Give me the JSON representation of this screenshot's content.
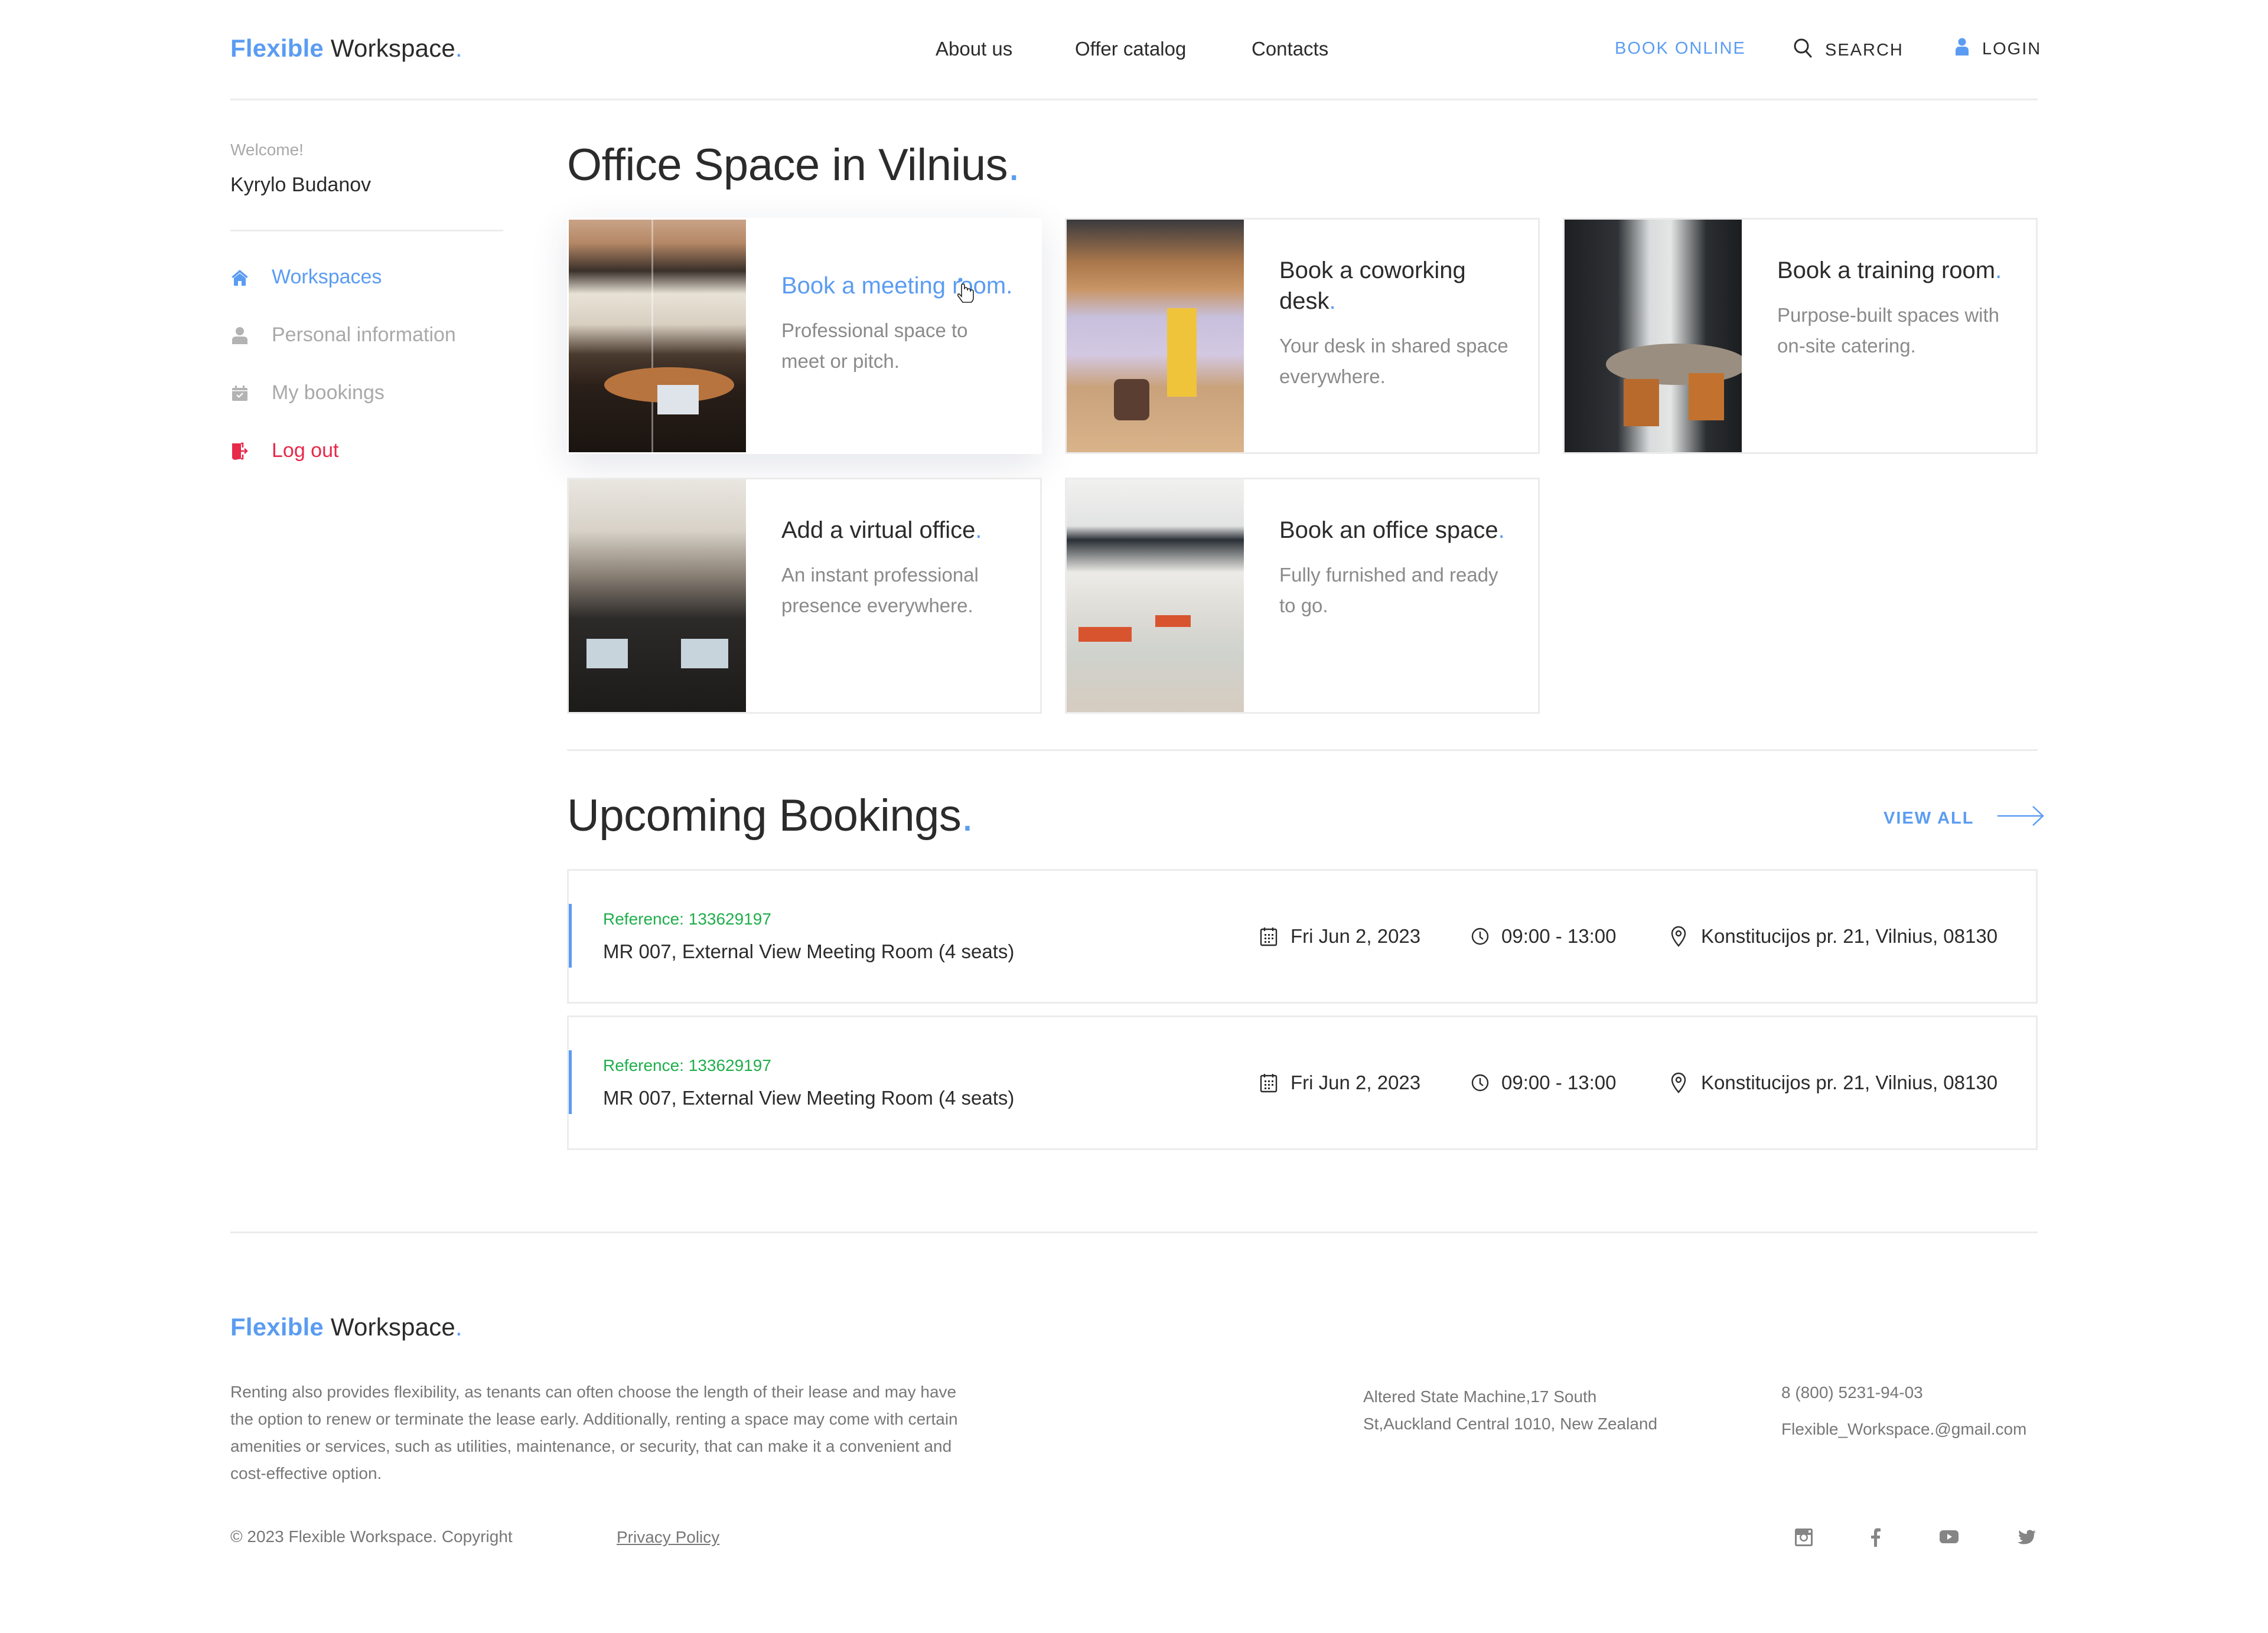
{
  "brand": {
    "part1": "Flexible",
    "part2": "Workspace",
    "dot": "."
  },
  "colors": {
    "accent": "#5b9cf2",
    "danger": "#e8294a",
    "success": "#1fae4b",
    "muted": "#a9a9a9"
  },
  "header": {
    "nav": [
      {
        "label": "About us"
      },
      {
        "label": "Offer catalog"
      },
      {
        "label": "Contacts"
      }
    ],
    "book_online": "BOOK ONLINE",
    "search": {
      "label": "SEARCH",
      "icon": "search-icon"
    },
    "login": {
      "label": "LOGIN",
      "icon": "user-icon"
    }
  },
  "sidebar": {
    "welcome": "Welcome!",
    "user_name": "Kyrylo Budanov",
    "items": [
      {
        "label": "Workspaces",
        "icon": "home-icon",
        "active": true
      },
      {
        "label": "Personal information",
        "icon": "user-icon"
      },
      {
        "label": "My bookings",
        "icon": "calendar-check-icon"
      },
      {
        "label": "Log out",
        "icon": "logout-icon",
        "danger": true
      }
    ]
  },
  "main": {
    "title": "Office Space in Vilnius",
    "title_dot": ".",
    "cards": [
      {
        "title": "Book a meeting room",
        "description": "Professional space to meet or pitch.",
        "state": "hover"
      },
      {
        "title": "Book a coworking desk",
        "description": "Your desk in shared space everywhere."
      },
      {
        "title": "Book a training room",
        "description": "Purpose-built spaces with on-site catering."
      },
      {
        "title": "Add a virtual office",
        "description": "An instant professional presence everywhere."
      },
      {
        "title": "Book an office space",
        "description": "Fully furnished and ready to go."
      }
    ],
    "bookings_title": "Upcoming Bookings",
    "view_all": "VIEW ALL",
    "bookings": [
      {
        "reference": "Reference: 133629197",
        "room": "MR 007, External View Meeting Room (4 seats)",
        "date": "Fri Jun 2, 2023",
        "time": "09:00 - 13:00",
        "address": "Konstitucijos pr. 21, Vilnius, 08130"
      },
      {
        "reference": "Reference: 133629197",
        "room": "MR 007, External View Meeting Room (4 seats)",
        "date": "Fri Jun 2, 2023",
        "time": "09:00 - 13:00",
        "address": "Konstitucijos pr. 21, Vilnius, 08130"
      }
    ]
  },
  "footer": {
    "about": "Renting also provides flexibility, as tenants can often choose the length of their lease and may have the option to renew or terminate the lease early. Additionally, renting a space may come with certain amenities or services, such as utilities, maintenance, or security, that can make it a convenient and cost-effective option.",
    "address_line1": "Altered State Machine,17 South",
    "address_line2": "St,Auckland Central 1010, New Zealand",
    "phone": "8 (800) 5231-94-03",
    "email": "Flexible_Workspace.@gmail.com",
    "copyright": "© 2023 Flexible Workspace. Copyright",
    "privacy": "Privacy Policy",
    "social": [
      "instagram-icon",
      "facebook-icon",
      "youtube-icon",
      "twitter-icon"
    ]
  }
}
